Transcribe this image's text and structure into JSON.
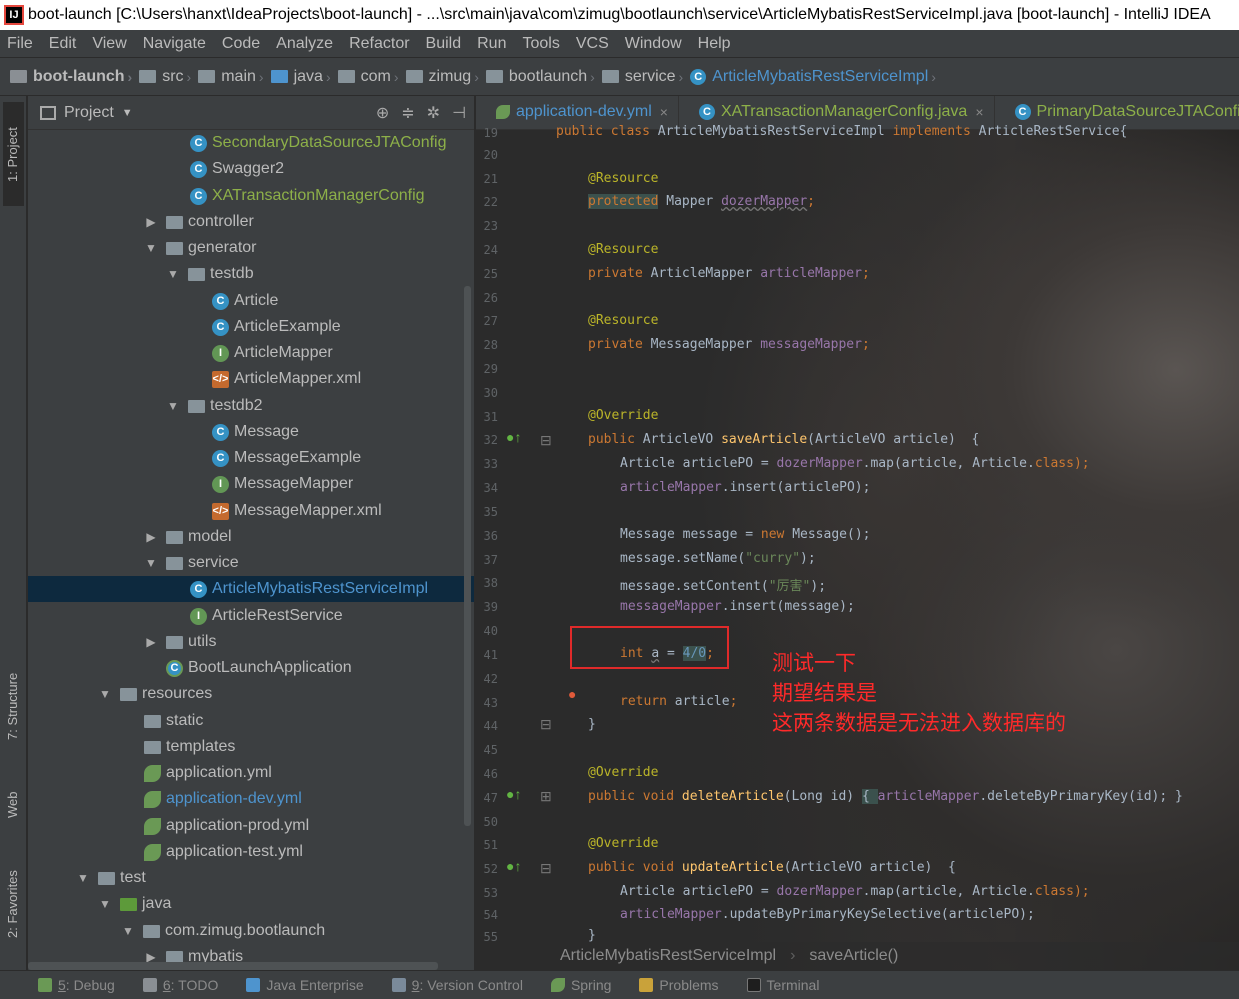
{
  "window": {
    "title": "boot-launch [C:\\Users\\hanxt\\IdeaProjects\\boot-launch] - ...\\src\\main\\java\\com\\zimug\\bootlaunch\\service\\ArticleMybatisRestServiceImpl.java [boot-launch] - IntelliJ IDEA"
  },
  "menu": [
    {
      "label": "File"
    },
    {
      "label": "Edit"
    },
    {
      "label": "View"
    },
    {
      "label": "Navigate"
    },
    {
      "label": "Code"
    },
    {
      "label": "Analyze"
    },
    {
      "label": "Refactor"
    },
    {
      "label": "Build"
    },
    {
      "label": "Run"
    },
    {
      "label": "Tools"
    },
    {
      "label": "VCS"
    },
    {
      "label": "Window"
    },
    {
      "label": "Help"
    }
  ],
  "breadcrumb": [
    {
      "label": "boot-launch"
    },
    {
      "label": "src"
    },
    {
      "label": "main"
    },
    {
      "label": "java"
    },
    {
      "label": "com"
    },
    {
      "label": "zimug"
    },
    {
      "label": "bootlaunch"
    },
    {
      "label": "service"
    },
    {
      "label": "ArticleMybatisRestServiceImpl"
    }
  ],
  "side_tabs": {
    "project": "1: Project",
    "structure": "7: Structure",
    "web": "Web",
    "favorites": "2: Favorites"
  },
  "project_panel": {
    "title": "Project",
    "tree": [
      {
        "label": "SecondaryDataSourceJTAConfig"
      },
      {
        "label": "Swagger2"
      },
      {
        "label": "XATransactionManagerConfig"
      },
      {
        "label": "controller"
      },
      {
        "label": "generator"
      },
      {
        "label": "testdb"
      },
      {
        "label": "Article"
      },
      {
        "label": "ArticleExample"
      },
      {
        "label": "ArticleMapper"
      },
      {
        "label": "ArticleMapper.xml"
      },
      {
        "label": "testdb2"
      },
      {
        "label": "Message"
      },
      {
        "label": "MessageExample"
      },
      {
        "label": "MessageMapper"
      },
      {
        "label": "MessageMapper.xml"
      },
      {
        "label": "model"
      },
      {
        "label": "service"
      },
      {
        "label": "ArticleMybatisRestServiceImpl"
      },
      {
        "label": "ArticleRestService"
      },
      {
        "label": "utils"
      },
      {
        "label": "BootLaunchApplication"
      },
      {
        "label": "resources"
      },
      {
        "label": "static"
      },
      {
        "label": "templates"
      },
      {
        "label": "application.yml"
      },
      {
        "label": "application-dev.yml"
      },
      {
        "label": "application-prod.yml"
      },
      {
        "label": "application-test.yml"
      },
      {
        "label": "test"
      },
      {
        "label": "java"
      },
      {
        "label": "com.zimug.bootlaunch"
      },
      {
        "label": "mybatis"
      }
    ]
  },
  "editor_tabs": [
    {
      "label": "application-dev.yml"
    },
    {
      "label": "XATransactionManagerConfig.java"
    },
    {
      "label": "PrimaryDataSourceJTAConfig"
    }
  ],
  "line_numbers": [
    "19",
    "20",
    "21",
    "22",
    "23",
    "24",
    "25",
    "26",
    "27",
    "28",
    "29",
    "30",
    "31",
    "32",
    "33",
    "34",
    "35",
    "36",
    "37",
    "38",
    "39",
    "40",
    "41",
    "42",
    "43",
    "44",
    "45",
    "46",
    "47",
    "50",
    "51",
    "52",
    "53",
    "54",
    "55"
  ],
  "code": {
    "l19_a": "public class ",
    "l19_b": "ArticleMybatisRestServiceImpl ",
    "l19_c": "implements ",
    "l19_d": "ArticleRestService{",
    "ann_resource": "@Resource",
    "ann_override": "@Override",
    "l22_a": "protected",
    "l22_b": " Mapper ",
    "l22_c": "dozerMapper",
    "l22_d": ";",
    "l25_a": "private ",
    "l25_b": "ArticleMapper ",
    "l25_c": "articleMapper",
    "l25_d": ";",
    "l28_a": "private ",
    "l28_b": "MessageMapper ",
    "l28_c": "messageMapper",
    "l28_d": ";",
    "l32_a": "public ",
    "l32_b": "ArticleVO ",
    "l32_c": "saveArticle",
    "l32_d": "(ArticleVO article)  {",
    "l33_a": "Article articlePO = ",
    "l33_b": "dozerMapper",
    "l33_c": ".map(article, Article.",
    "l33_d": "class",
    "l33_e": ");",
    "l34_a": "articleMapper",
    "l34_b": ".insert(articlePO);",
    "l36_a": "Message message = ",
    "l36_b": "new ",
    "l36_c": "Message();",
    "l37_a": "message.setName(",
    "l37_b": "\"curry\"",
    "l37_c": ");",
    "l38_a": "message.setContent(",
    "l38_b": "\"厉害\"",
    "l38_c": ");",
    "l39_a": "messageMapper",
    "l39_b": ".insert(message);",
    "l41_a": "int ",
    "l41_b": "a",
    "l41_c": " = ",
    "l41_d": "4/0",
    "l41_e": ";",
    "l43_a": "return ",
    "l43_b": "article",
    "l43_c": ";",
    "l44": "}",
    "l47_a": "public void ",
    "l47_b": "deleteArticle",
    "l47_c": "(Long id) ",
    "l47_d": "{ ",
    "l47_e": "articleMapper",
    "l47_f": ".deleteByPrimaryKey(id); }",
    "l52_a": "public void ",
    "l52_b": "updateArticle",
    "l52_c": "(ArticleVO article)  {",
    "l53_a": "Article articlePO = ",
    "l53_b": "dozerMapper",
    "l53_c": ".map(article, Article.",
    "l53_d": "class",
    "l53_e": ");",
    "l54_a": "articleMapper",
    "l54_b": ".updateByPrimaryKeySelective(articlePO);",
    "l55": "}"
  },
  "annotation_text": [
    "测试一下",
    "期望结果是",
    "这两条数据是无法进入数据库的"
  ],
  "editor_breadcrumb": {
    "class": "ArticleMybatisRestServiceImpl",
    "method": "saveArticle()"
  },
  "bottom_tools": [
    {
      "num": "5",
      "label": ": Debug"
    },
    {
      "num": "6",
      "label": ": TODO"
    },
    {
      "num": "",
      "label": "Java Enterprise"
    },
    {
      "num": "9",
      "label": ": Version Control"
    },
    {
      "num": "",
      "label": "Spring"
    },
    {
      "num": "",
      "label": "Problems"
    },
    {
      "num": "",
      "label": "Terminal"
    }
  ]
}
